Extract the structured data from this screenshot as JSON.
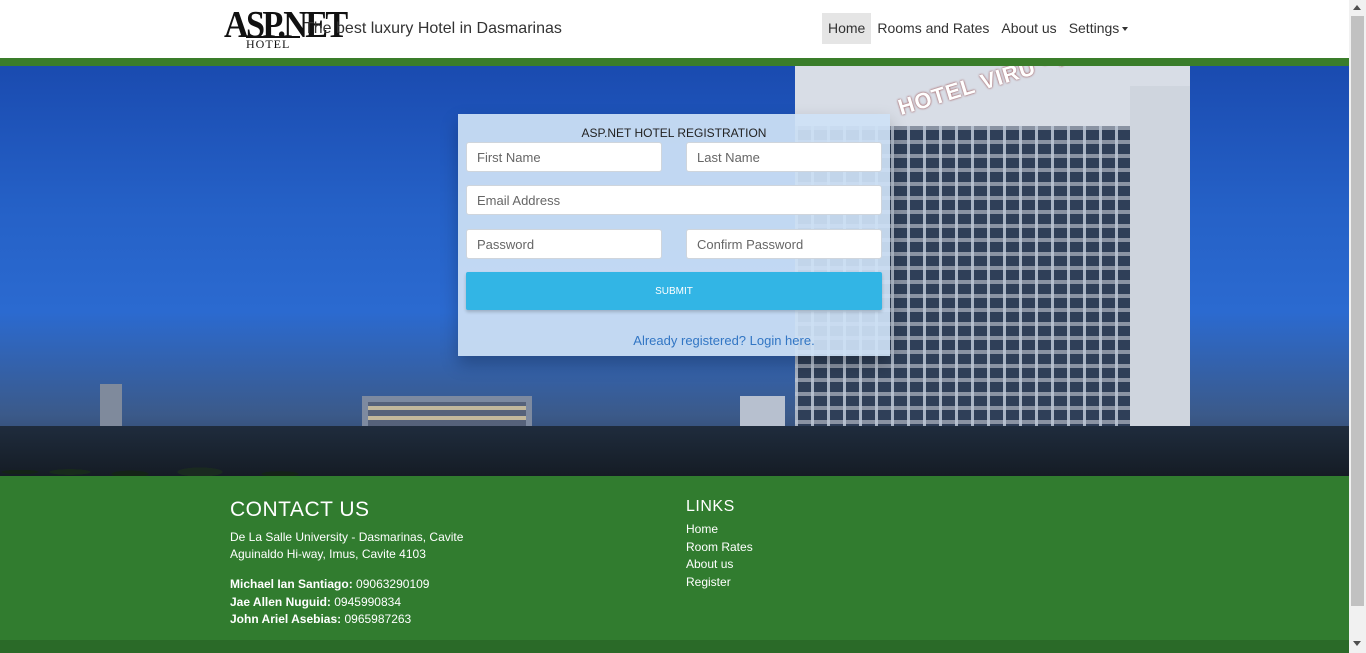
{
  "brand": {
    "logo_big": "ASP.NET",
    "logo_small": "HOTEL",
    "tagline": "The best luxury Hotel in Dasmarinas"
  },
  "nav": {
    "items": [
      {
        "label": "Home",
        "active": true
      },
      {
        "label": "Rooms and Rates"
      },
      {
        "label": "About us"
      },
      {
        "label": "Settings",
        "dropdown": true
      }
    ]
  },
  "hero": {
    "sign_text": "HOTEL VIRU · ID-SANTIAGO-ASEBIAS"
  },
  "form": {
    "title": "ASP.NET HOTEL REGISTRATION",
    "first_name_placeholder": "First Name",
    "last_name_placeholder": "Last Name",
    "email_placeholder": "Email Address",
    "password_placeholder": "Password",
    "confirm_password_placeholder": "Confirm Password",
    "submit_label": "SUBMIT",
    "login_link": "Already registered? Login here."
  },
  "footer": {
    "contact_title": "CONTACT US",
    "address_line1": "De La Salle University - Dasmarinas, Cavite",
    "address_line2": "Aguinaldo Hi-way, Imus, Cavite 4103",
    "people": [
      {
        "name": "Michael Ian Santiago:",
        "phone": "09063290109"
      },
      {
        "name": "Jae Allen Nuguid:",
        "phone": "0945990834"
      },
      {
        "name": "John Ariel Asebias:",
        "phone": "0965987263"
      }
    ],
    "links_title": "LINKS",
    "links": [
      "Home",
      "Room Rates",
      "About us",
      "Register"
    ]
  },
  "colors": {
    "accent_green": "#317c2f",
    "submit_blue": "#32b5e5",
    "link_blue": "#3276c4"
  }
}
